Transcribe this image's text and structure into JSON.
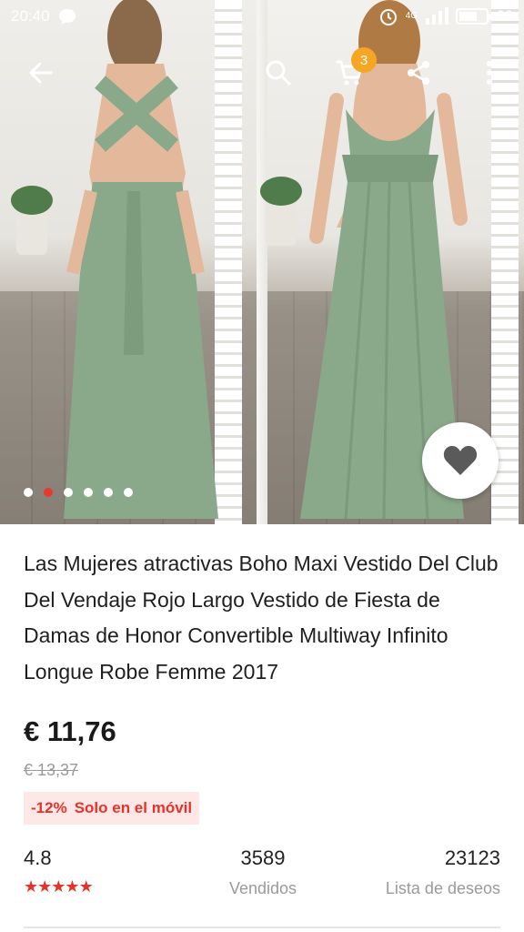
{
  "status_bar": {
    "time": "20:40",
    "battery": "63",
    "network": "4G"
  },
  "header": {
    "cart_count": "3",
    "icons": [
      "back-arrow-icon",
      "search-icon",
      "cart-icon",
      "share-icon",
      "more-vert-icon"
    ]
  },
  "gallery": {
    "dot_count": 6,
    "active_index": 1
  },
  "product": {
    "title": "Las Mujeres atractivas Boho Maxi Vestido Del Club Del Vendaje Rojo Largo Vestido de Fiesta de Damas de Honor Convertible Multiway Infinito Longue Robe Femme 2017",
    "price": "€ 11,76",
    "old_price": "€ 13,37",
    "discount": "-12%",
    "promo_label": "Solo en el móvil"
  },
  "stats": {
    "rating": "4.8",
    "rating_stars": 5,
    "sold_value": "3589",
    "sold_label": "Vendidos",
    "wishlist_value": "23123",
    "wishlist_label": "Lista de deseos"
  },
  "colors": {
    "accent_red": "#e6332a",
    "badge_orange": "#f5a623",
    "dress_green": "#8aa88a"
  }
}
